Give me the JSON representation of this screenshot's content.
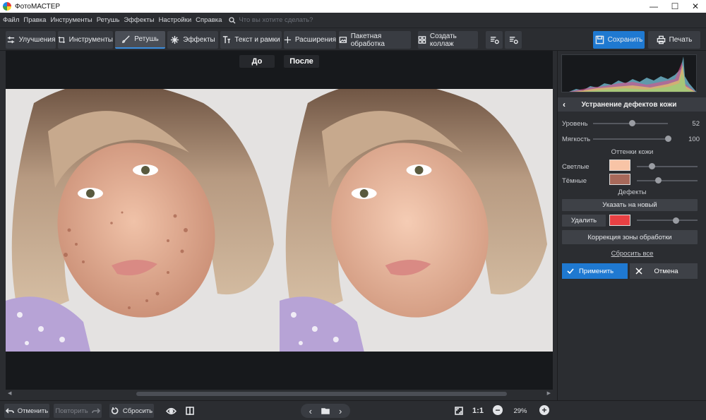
{
  "window": {
    "title": "ФотоМАСТЕР",
    "minimize": "—",
    "maximize": "☐",
    "close": "✕"
  },
  "menu": {
    "items": [
      "Файл",
      "Правка",
      "Инструменты",
      "Ретушь",
      "Эффекты",
      "Настройки",
      "Справка"
    ],
    "search_placeholder": "Что вы хотите сделать?"
  },
  "toolbar": {
    "tabs": [
      {
        "label": "Улучшения",
        "icon": "sliders-icon",
        "active": false
      },
      {
        "label": "Инструменты",
        "icon": "crop-icon",
        "active": false
      },
      {
        "label": "Ретушь",
        "icon": "brush-icon",
        "active": true
      },
      {
        "label": "Эффекты",
        "icon": "sparkle-icon",
        "active": false
      },
      {
        "label": "Текст и рамки",
        "icon": "text-icon",
        "active": false
      },
      {
        "label": "Расширения",
        "icon": "plus-icon",
        "active": false
      }
    ],
    "batch": "Пакетная обработка",
    "collage": "Создать коллаж",
    "save": "Сохранить",
    "print": "Печать"
  },
  "compare": {
    "before": "До",
    "after": "После"
  },
  "panel": {
    "title": "Устранение дефектов кожи",
    "level_label": "Уровень",
    "level_value": "52",
    "level_fraction": 0.52,
    "softness_label": "Мягкость",
    "softness_value": "100",
    "softness_fraction": 1.0,
    "skin_tones_title": "Оттенки кожи",
    "light_label": "Светлые",
    "light_color": "#f8c4a6",
    "light_fraction": 0.25,
    "dark_label": "Тёмные",
    "dark_color": "#a8695a",
    "dark_fraction": 0.35,
    "defects_title": "Дефекты",
    "specify_new": "Указать на новый",
    "remove": "Удалить",
    "defect_color": "#e84043",
    "defect_fraction": 0.65,
    "zone_correction": "Коррекция зоны обработки",
    "reset_all": "Сбросить все",
    "apply": "Применить",
    "cancel": "Отмена"
  },
  "bottom": {
    "undo": "Отменить",
    "redo": "Повторить",
    "reset": "Сбросить",
    "zoom_ratio": "1:1",
    "zoom_percent": "29%"
  },
  "colors": {
    "accent": "#1f79d1",
    "background": "#2b2d31",
    "canvas": "#17191c"
  }
}
